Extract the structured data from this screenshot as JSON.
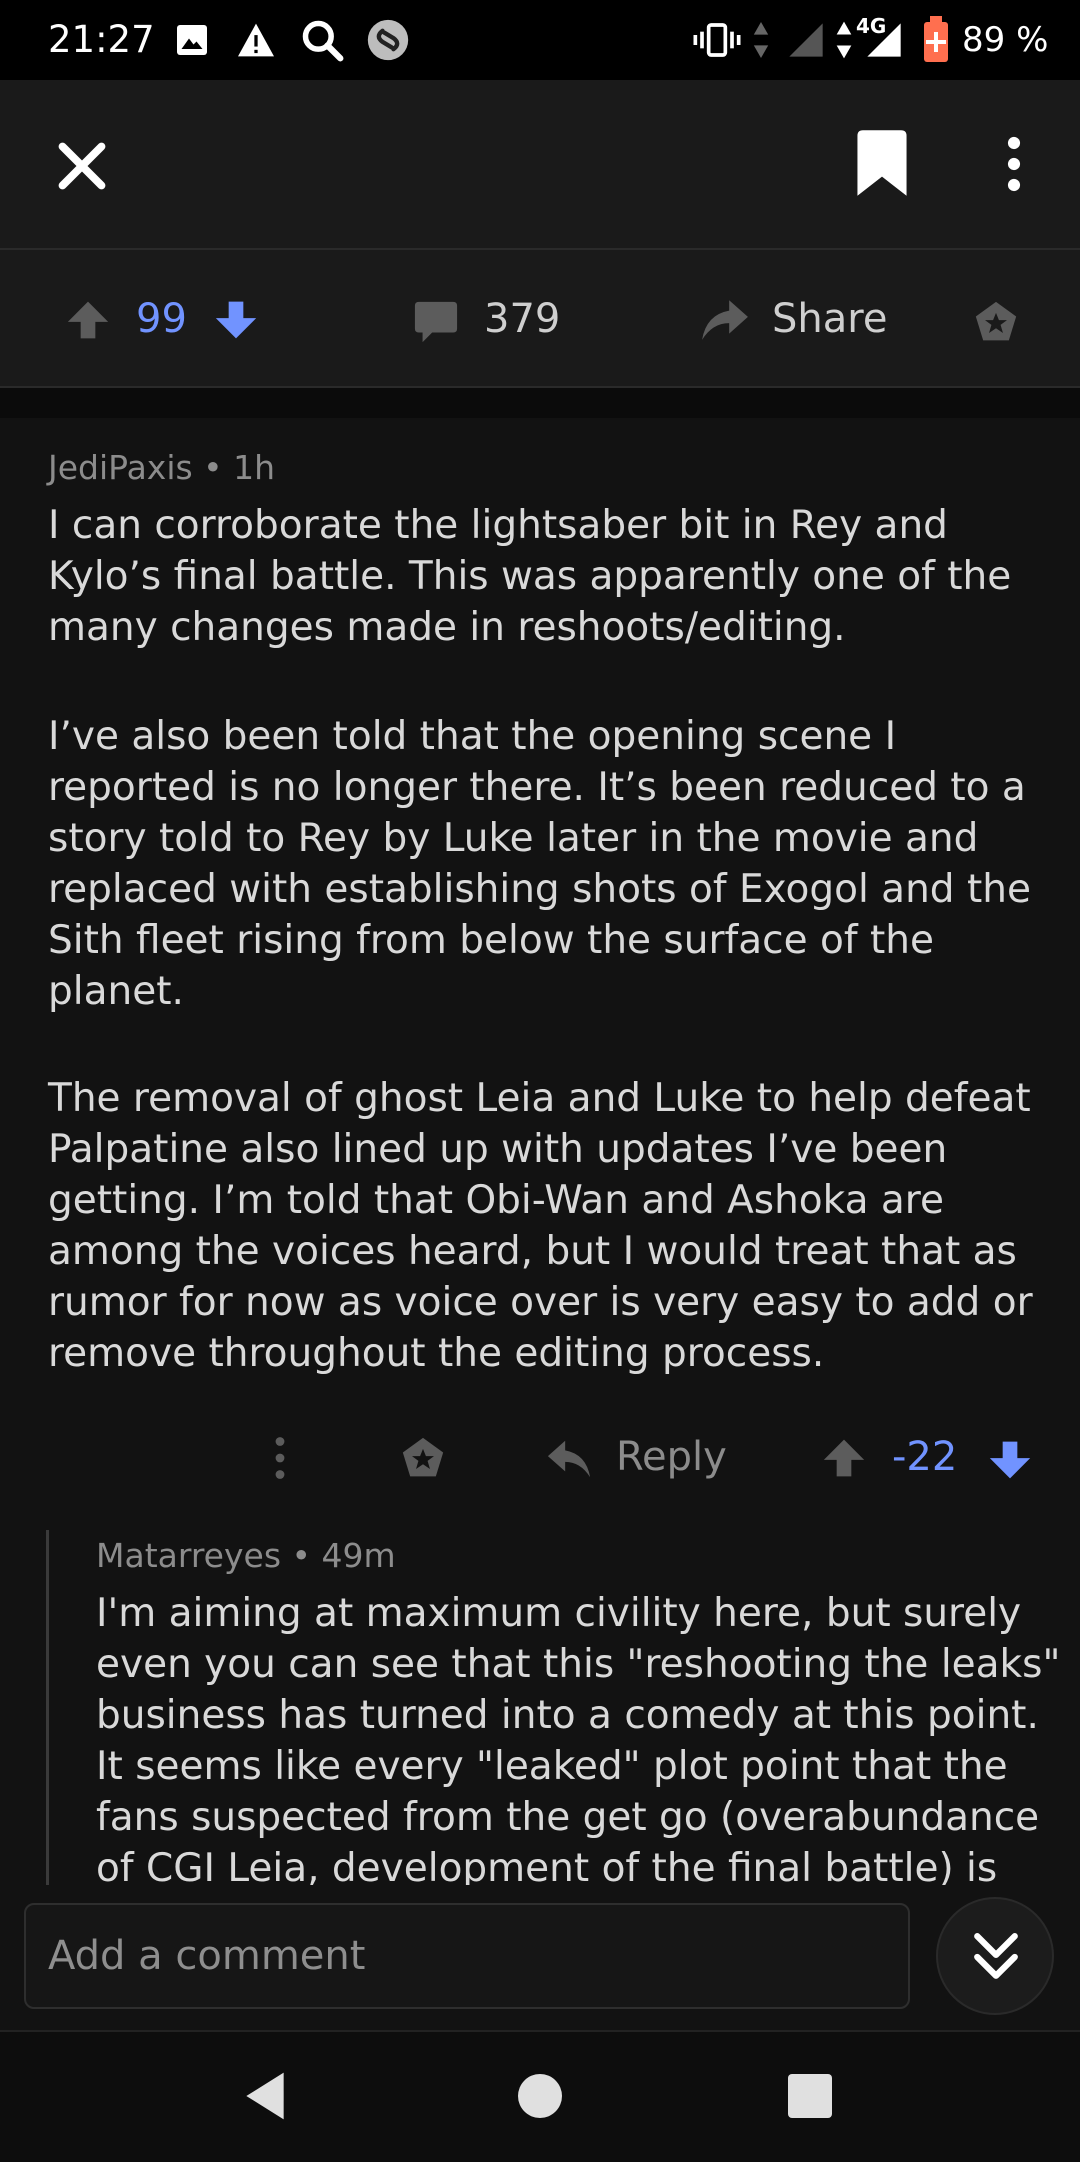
{
  "status_bar": {
    "time": "21:27",
    "battery": "89 %",
    "network": "4G",
    "icons": [
      "image-icon",
      "warning-icon",
      "search-icon",
      "shazam-icon",
      "vibrate-icon",
      "signal-icon",
      "battery-saver-icon"
    ]
  },
  "top_bar": {
    "close_icon": "close-icon",
    "bookmark_icon": "bookmark-icon",
    "more_icon": "more-vert-icon"
  },
  "post_actions": {
    "score": "99",
    "comments": "379",
    "share_label": "Share",
    "colors": {
      "accent_blue": "#7193ff"
    }
  },
  "comments": [
    {
      "author": "JediPaxis",
      "age": "1h",
      "paragraphs": [
        "I can corroborate the lightsaber bit in Rey and Kylo’s final battle. This was apparently one of the many changes made in reshoots/editing.",
        "I’ve also been told that the opening scene I reported is no longer there. It’s been reduced to a story told to Rey by Luke later in the movie and replaced with establishing shots of Exogol and the Sith fleet rising from below the surface of the planet.",
        "The removal of ghost Leia and Luke to help defeat Palpatine also lined up with updates I’ve been getting. I’m told that Obi-Wan and Ashoka are among the voices heard, but I would treat that as rumor for now as voice over is very easy to add or remove throughout the editing process."
      ],
      "reply_label": "Reply",
      "score": "-22"
    },
    {
      "author": "Matarreyes",
      "age": "49m",
      "text": "I'm aiming at maximum  civility here, but surely even you can see that this \"reshooting the leaks\" business has turned into a comedy at this point. It seems like every \"leaked\" plot point that the fans suspected from the get go (overabundance of CGI Leia, development of the final battle) is"
    }
  ],
  "comment_bar": {
    "placeholder": "Add a comment"
  },
  "nav_bar": {
    "icons": [
      "back-icon",
      "home-icon",
      "recents-icon"
    ]
  }
}
